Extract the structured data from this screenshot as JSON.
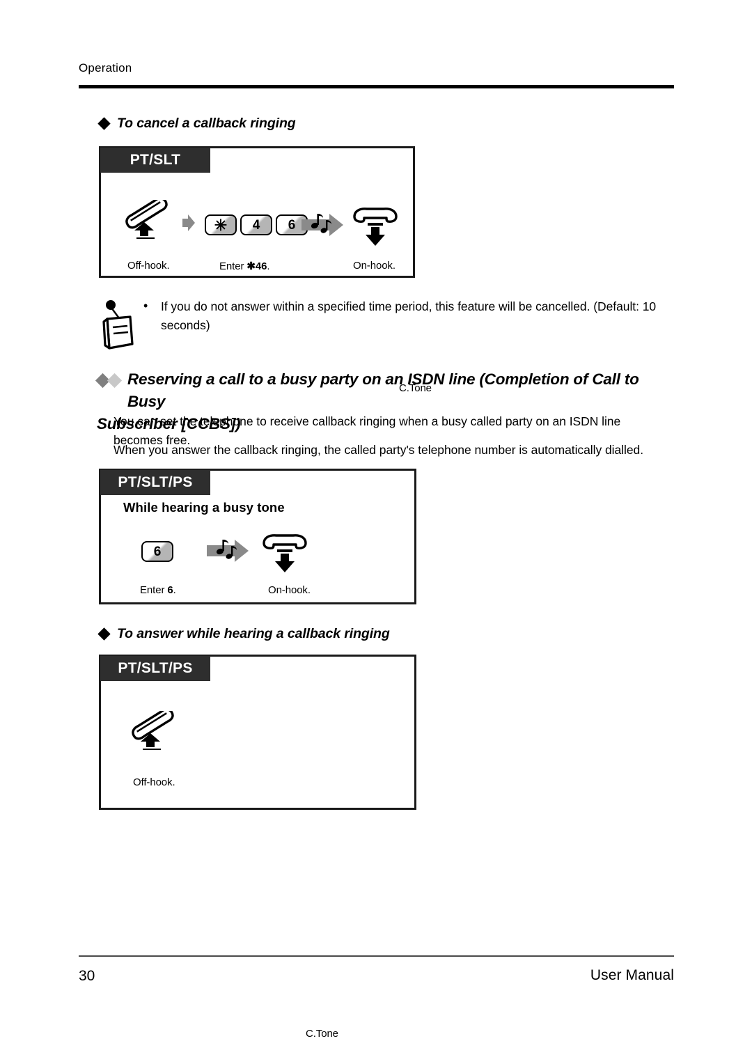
{
  "page": {
    "running_header": "Operation",
    "footer_page_number": "30",
    "footer_title": "User Manual"
  },
  "sections": [
    {
      "id": "cancel-callback",
      "heading": "To cancel a callback ringing",
      "bullet_icon": "diamond-bullet-icon",
      "box": {
        "tab_label": "PT/SLT",
        "steps": [
          {
            "icon": "offhook-handset-icon",
            "caption": "Off-hook."
          },
          {
            "icon": "gray-arrow-icon",
            "caption": ""
          },
          {
            "keys": [
              "✳",
              "4",
              "6"
            ],
            "caption_prefix": "Enter ",
            "caption_bold": "✱46",
            "caption_suffix": "."
          },
          {
            "icon": "confirmation-tone-icon",
            "tone_label": "C.Tone",
            "caption": ""
          },
          {
            "icon": "onhook-handset-icon",
            "caption": "On-hook."
          }
        ]
      }
    },
    {
      "id": "ccbs",
      "bullet_icon": "double-diamond-bullet-icon",
      "heading_line1": "Reserving a call to a busy party on an ISDN line (Completion of Call to Busy",
      "heading_line2": "Subscriber [CCBS])",
      "paragraph1": "You can set the telephone to receive callback ringing when a busy called party on an ISDN line becomes free.",
      "paragraph2": "When you answer the callback ringing, the called party's telephone number is automatically dialled.",
      "box": {
        "tab_label": "PT/SLT/PS",
        "subtitle": "While hearing a busy tone",
        "steps": [
          {
            "key": "6",
            "caption_prefix": "Enter ",
            "caption_bold": "6",
            "caption_suffix": "."
          },
          {
            "icon": "confirmation-tone-icon",
            "tone_label": "C.Tone"
          },
          {
            "icon": "onhook-handset-icon",
            "caption": "On-hook."
          }
        ]
      }
    },
    {
      "id": "answer-callback",
      "heading": "To answer while hearing a callback ringing",
      "bullet_icon": "diamond-bullet-icon",
      "box": {
        "tab_label": "PT/SLT/PS",
        "steps": [
          {
            "icon": "offhook-handset-icon",
            "caption": "Off-hook."
          }
        ]
      }
    }
  ],
  "note": {
    "icon": "note-pen-icon",
    "bullet": "•",
    "text": "If you do not answer within a specified time period, this feature will be cancelled. (Default: 10 seconds)"
  },
  "colors": {
    "tab_background": "#2e2e2e",
    "box_border": "#1a1a1a",
    "key_shade": "#b5b5b5",
    "gray_arrow": "#808080",
    "diamond_dark": "#808080",
    "diamond_light": "#c8c8c8",
    "rule": "#000000"
  }
}
